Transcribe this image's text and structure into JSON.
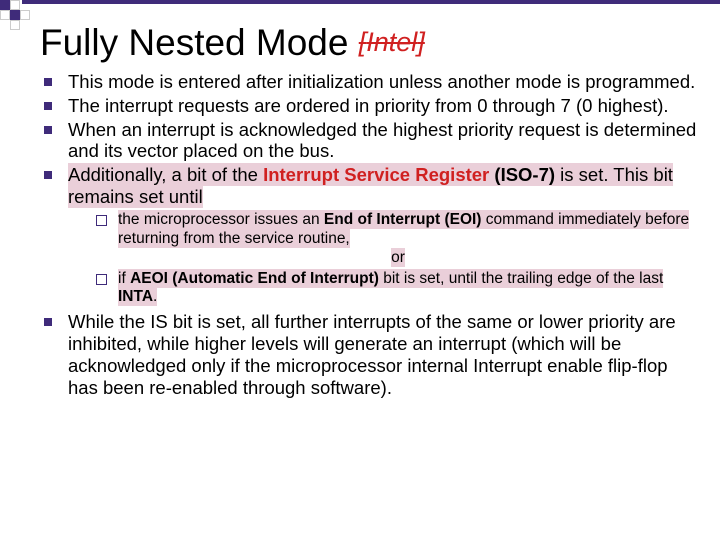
{
  "title": {
    "main": "Fully Nested Mode ",
    "suffix_open": "[",
    "suffix_text": "Intel",
    "suffix_close": "]"
  },
  "bullets": [
    "This mode is entered after initialization unless another mode is programmed.",
    "The interrupt requests are ordered in priority from 0 through 7 (0 highest).",
    "When an interrupt is acknowledged the highest priority request is determined and its vector placed on the bus."
  ],
  "bullet4": {
    "pre": "Additionally, a bit of the ",
    "isr": "Interrupt Service Register",
    "iso": " (ISO-7)",
    "post": " is set. This bit remains set until"
  },
  "sub": {
    "a_pre": "the microprocessor issues an ",
    "a_eoi": "End of Interrupt",
    "a_eoi2": " (EOI)",
    "a_post": " command immediately before returning from the service routine,",
    "or": "or",
    "b_pre": "if ",
    "b_aeoi": "AEOI",
    "b_aeoi2": " (Automatic End of Interrupt)",
    "b_post": " bit is set, until the trailing edge of the last ",
    "b_inta": "INTA",
    "b_dot": "."
  },
  "bullet5": "While the IS bit is set, all further interrupts of the same or lower priority are inhibited, while higher levels will generate an interrupt (which will be acknowledged only if the microprocessor internal Interrupt enable flip-flop has been re-enabled through software)."
}
